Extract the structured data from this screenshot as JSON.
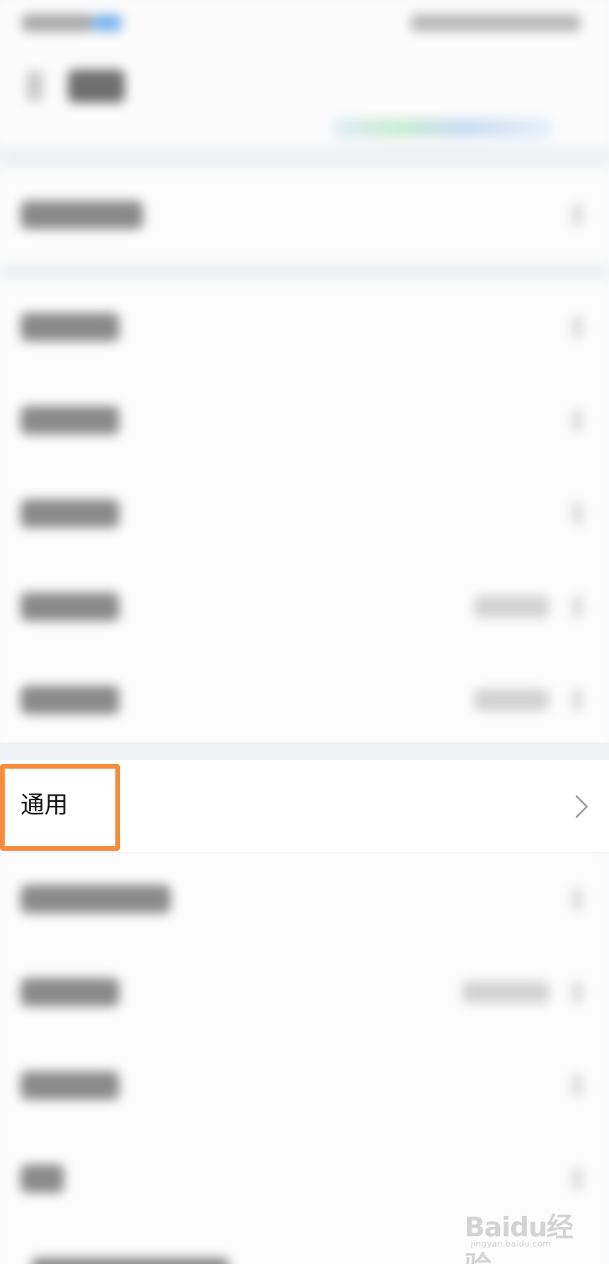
{
  "settings": {
    "general_label": "通用"
  },
  "watermark": {
    "text": "Baidu经验",
    "url": "jingyan.baidu.com"
  },
  "colors": {
    "highlight": "#fa8b3c",
    "chevron": "#a0a0a0"
  },
  "icons": {
    "general_chevron": "chevron-right-icon"
  }
}
